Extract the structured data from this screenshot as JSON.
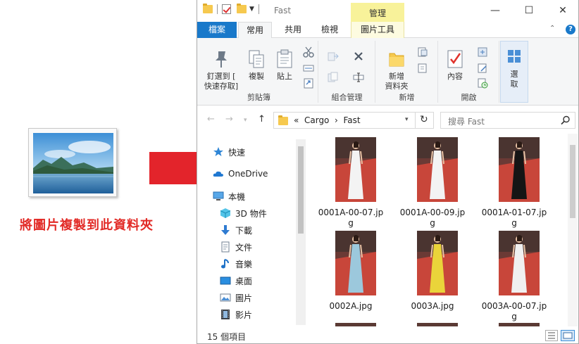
{
  "caption": "將圖片複製到此資料夾",
  "window": {
    "title": "Fast",
    "context_tab": "管理",
    "minimize": "—",
    "maximize": "☐",
    "close": "✕"
  },
  "tabs": {
    "file": "檔案",
    "home": "常用",
    "share": "共用",
    "view": "檢視",
    "picture_tools": "圖片工具",
    "help": "?"
  },
  "ribbon": {
    "pin_line1": "釘選到 [",
    "pin_line2": "快速存取]",
    "copy": "複製",
    "paste": "貼上",
    "clipboard_group": "剪貼簿",
    "organize_group": "組合管理",
    "new_folder_line1": "新增",
    "new_folder_line2": "資料夾",
    "new_group": "新增",
    "properties": "內容",
    "open_group": "開啟",
    "select_line1": "選",
    "select_line2": "取"
  },
  "address": {
    "prefix": "«",
    "crumb1": "Cargo",
    "sep": "›",
    "crumb2": "Fast",
    "search_placeholder": "搜尋 Fast"
  },
  "nav": {
    "quick_access": "快速",
    "onedrive": "OneDrive",
    "this_pc": "本機",
    "objects3d": "3D 物件",
    "downloads": "下載",
    "documents": "文件",
    "music": "音樂",
    "desktop": "桌面",
    "pictures": "圖片",
    "videos": "影片"
  },
  "files": [
    {
      "line1": "0001A-00-07.jp",
      "line2": "g",
      "dress": "#f3f3f3"
    },
    {
      "line1": "0001A-00-09.jp",
      "line2": "g",
      "dress": "#f3f3f3"
    },
    {
      "line1": "0001A-01-07.jp",
      "line2": "g",
      "dress": "#151515"
    },
    {
      "line1": "0002A.jpg",
      "line2": "",
      "dress": "#9cc8dc"
    },
    {
      "line1": "0003A.jpg",
      "line2": "",
      "dress": "#ead43a"
    },
    {
      "line1": "0003A-00-07.jp",
      "line2": "g",
      "dress": "#f0f0f0"
    }
  ],
  "status": {
    "count": "15 個項目"
  },
  "colors": {
    "accent": "#1979ca",
    "arrow": "#e3242b",
    "carpet": "#c8463a",
    "caption": "#e22b27"
  }
}
